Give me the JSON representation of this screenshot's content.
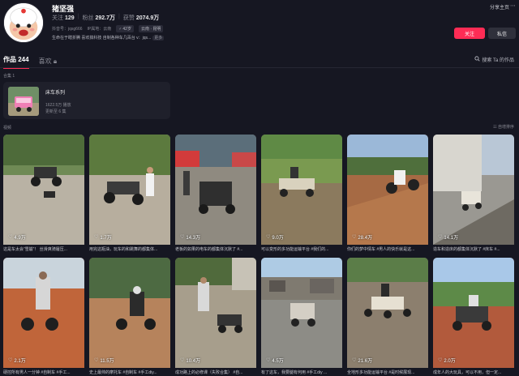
{
  "profile": {
    "name": "猪坚强",
    "following_label": "关注",
    "following_count": "129",
    "fans_label": "粉丝",
    "fans_count": "292.7万",
    "likes_label": "获赞",
    "likes_count": "2074.9万",
    "douyin_id": "抖音号：jqsg666",
    "ip_location": "IP属地：云南",
    "age_chip": "42岁",
    "region_chip": "云南 · 昆明",
    "bio": "生命在于瞎折腾 喜欢搞科技 自制各种车几百台 v：jqs...",
    "bio_more": "更多"
  },
  "actions": {
    "share": "分享主页",
    "share_more_icon": "more-icon",
    "follow": "关注",
    "message": "私信"
  },
  "tabs": [
    {
      "label": "作品 244"
    },
    {
      "label": "喜欢"
    }
  ],
  "search_works": "搜索 Ta 的作品",
  "collections_label": "合集 1",
  "collection": {
    "title": "床车系列",
    "views": "1622.5万 播放",
    "episodes": "更新至 6 集"
  },
  "videos_label": "视频",
  "sort_label": "☷ 自增排序",
  "videos": [
    {
      "likes": "4.9万",
      "caption": "这是车太会“雪崩”！ 丝滑爽骑履压..."
    },
    {
      "likes": "1.7万",
      "caption": "用完这瓶油，玩车的和跳舞的都集体..."
    },
    {
      "likes": "14.3万",
      "caption": "老板的如果的电车的都集体沉默了 #..."
    },
    {
      "likes": "9.0万",
      "caption": "可以变形的多功能运输平台 #我们的..."
    },
    {
      "likes": "28.4万",
      "caption": "你们的梦中情车 #男人的快乐就是这..."
    },
    {
      "likes": "14.1万",
      "caption": "造车和造床的都集体沉默了 #床车 #..."
    },
    {
      "likes": "2.1万",
      "caption": "硬控所有男人一分钟 #自制车 #手工..."
    },
    {
      "likes": "11.5万",
      "caption": "史上最帅的摩托车 #自制车 #手工diy..."
    },
    {
      "likes": "10.4万",
      "caption": "成功路上的必修课（失败合集） #自..."
    },
    {
      "likes": "4.5万",
      "caption": "有了这车，我要腿有何用 #手工diy ..."
    },
    {
      "likes": "21.6万",
      "caption": "全地形多功能运输平台 #是时候展现..."
    },
    {
      "likes": "2.0万",
      "caption": "成年人的大玩具，可以不用，但一定..."
    }
  ],
  "colors": {
    "accent": "#fe2c55",
    "background": "#161722"
  }
}
